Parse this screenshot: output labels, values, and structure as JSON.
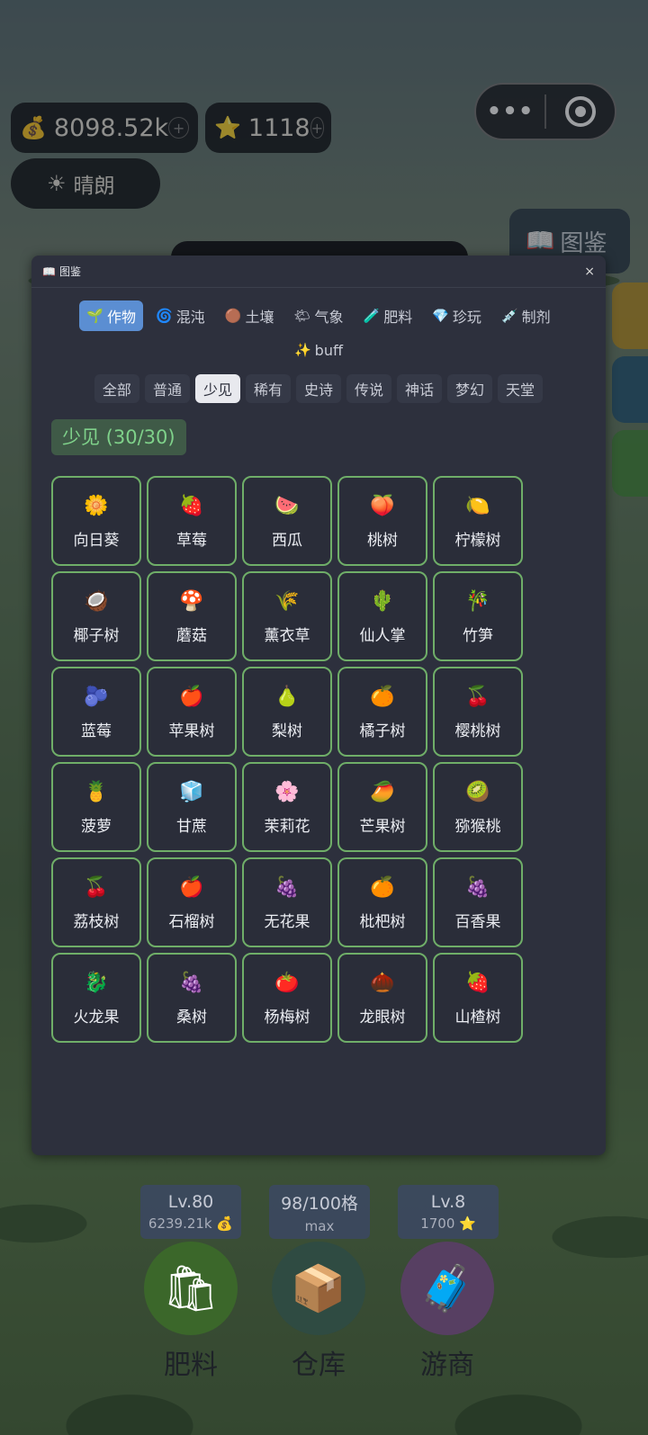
{
  "hud": {
    "coins": "8098.52k",
    "stars": "1118",
    "weather": "晴朗",
    "plus": "+"
  },
  "capsule": {
    "more": "•••"
  },
  "side": {
    "tujian": "图鉴"
  },
  "modal": {
    "title": "图鉴",
    "close": "×",
    "categories": [
      {
        "icon": "🌱",
        "label": "作物"
      },
      {
        "icon": "🌀",
        "label": "混沌"
      },
      {
        "icon": "🟤",
        "label": "土壤"
      },
      {
        "icon": "🌤",
        "label": "气象"
      },
      {
        "icon": "🧪",
        "label": "肥料"
      },
      {
        "icon": "💎",
        "label": "珍玩"
      },
      {
        "icon": "💉",
        "label": "制剂"
      },
      {
        "icon": "✨",
        "label": "buff"
      }
    ],
    "rarities": [
      "全部",
      "普通",
      "少见",
      "稀有",
      "史诗",
      "传说",
      "神话",
      "梦幻",
      "天堂"
    ],
    "section_title": "少见 (30/30)",
    "items": [
      {
        "icon": "🌼",
        "name": "向日葵"
      },
      {
        "icon": "🍓",
        "name": "草莓"
      },
      {
        "icon": "🍉",
        "name": "西瓜"
      },
      {
        "icon": "🍑",
        "name": "桃树"
      },
      {
        "icon": "🍋",
        "name": "柠檬树"
      },
      {
        "icon": "🥥",
        "name": "椰子树"
      },
      {
        "icon": "🍄",
        "name": "蘑菇"
      },
      {
        "icon": "🌾",
        "name": "薰衣草"
      },
      {
        "icon": "🌵",
        "name": "仙人掌"
      },
      {
        "icon": "🎋",
        "name": "竹笋"
      },
      {
        "icon": "🫐",
        "name": "蓝莓"
      },
      {
        "icon": "🍎",
        "name": "苹果树"
      },
      {
        "icon": "🍐",
        "name": "梨树"
      },
      {
        "icon": "🍊",
        "name": "橘子树"
      },
      {
        "icon": "🍒",
        "name": "樱桃树"
      },
      {
        "icon": "🍍",
        "name": "菠萝"
      },
      {
        "icon": "🧊",
        "name": "甘蔗"
      },
      {
        "icon": "🌸",
        "name": "茉莉花"
      },
      {
        "icon": "🥭",
        "name": "芒果树"
      },
      {
        "icon": "🥝",
        "name": "猕猴桃"
      },
      {
        "icon": "🍒",
        "name": "荔枝树"
      },
      {
        "icon": "🍎",
        "name": "石榴树"
      },
      {
        "icon": "🍇",
        "name": "无花果"
      },
      {
        "icon": "🍊",
        "name": "枇杷树"
      },
      {
        "icon": "🍇",
        "name": "百香果"
      },
      {
        "icon": "🐉",
        "name": "火龙果"
      },
      {
        "icon": "🍇",
        "name": "桑树"
      },
      {
        "icon": "🍅",
        "name": "杨梅树"
      },
      {
        "icon": "🌰",
        "name": "龙眼树"
      },
      {
        "icon": "🍓",
        "name": "山楂树"
      }
    ]
  },
  "bottom": {
    "fertilizer": {
      "level": "Lv.80",
      "sub": "6239.21k 💰",
      "label": "肥料",
      "icon": "🛍"
    },
    "warehouse": {
      "level": "98/100格",
      "sub": "max",
      "label": "仓库",
      "icon": "📦"
    },
    "merchant": {
      "level": "Lv.8",
      "sub": "1700 ⭐",
      "label": "游商",
      "icon": "🧳"
    }
  }
}
